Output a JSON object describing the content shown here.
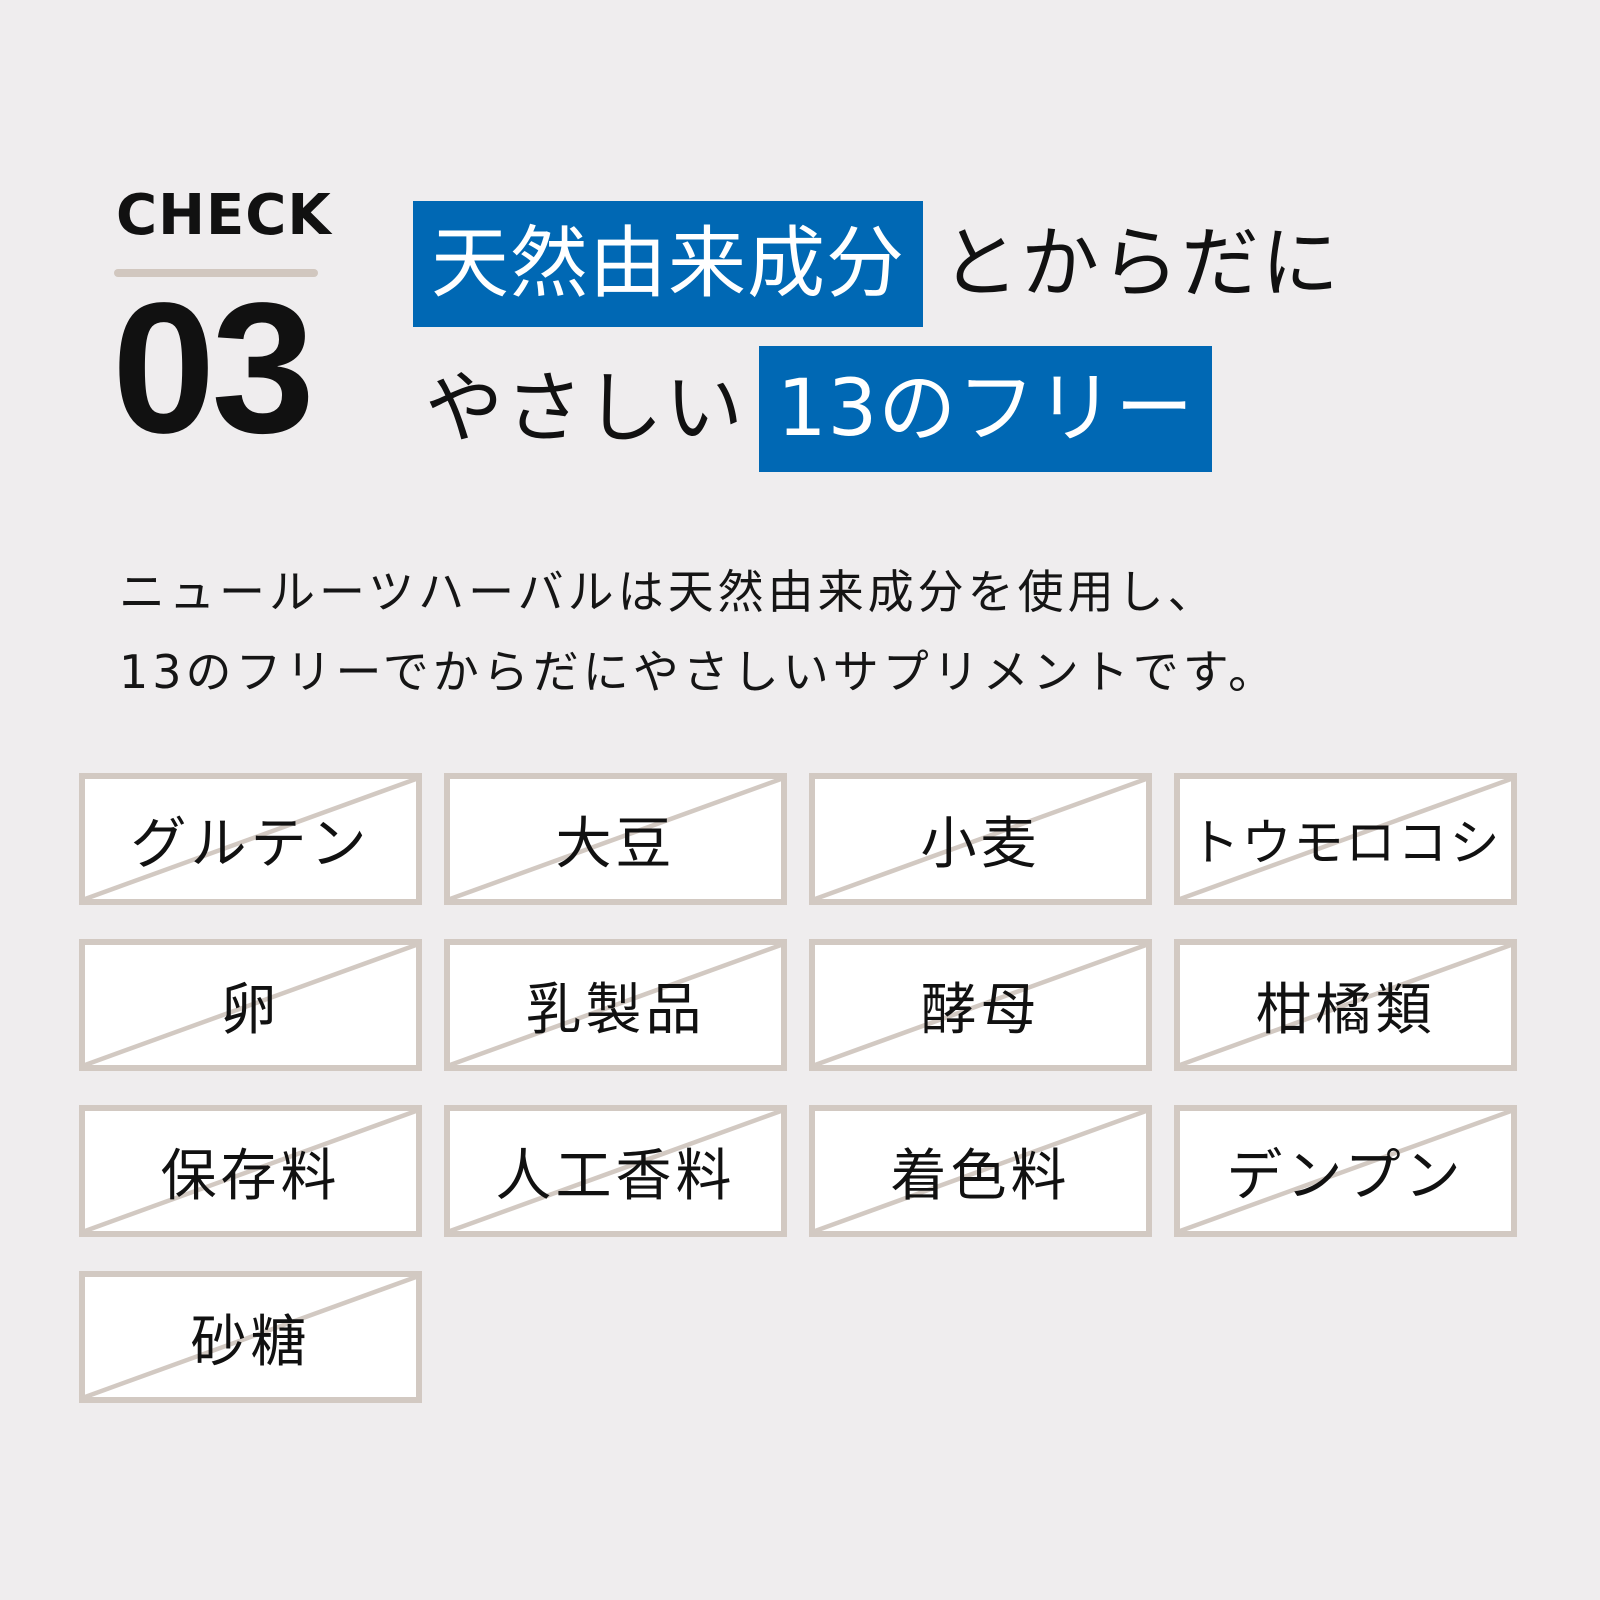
{
  "check": {
    "label": "CHECK",
    "number": "03"
  },
  "headline": {
    "line1_highlight": "天然由来成分",
    "line1_plain": "とからだに",
    "line2_plain": "やさしい",
    "line2_highlight": "13のフリー"
  },
  "description": {
    "line1": "ニュールーツハーバルは天然由来成分を使用し、",
    "line2": "13のフリーでからだにやさしいサプリメントです。"
  },
  "colors": {
    "accent": "#0068b4",
    "tile_border": "#d2c9c2",
    "background": "#efedee"
  },
  "free_items": [
    {
      "label": "グルテン"
    },
    {
      "label": "大豆"
    },
    {
      "label": "小麦"
    },
    {
      "label": "トウモロコシ"
    },
    {
      "label": "卵"
    },
    {
      "label": "乳製品"
    },
    {
      "label": "酵母"
    },
    {
      "label": "柑橘類"
    },
    {
      "label": "保存料"
    },
    {
      "label": "人工香料"
    },
    {
      "label": "着色料"
    },
    {
      "label": "デンプン"
    },
    {
      "label": "砂糖"
    }
  ]
}
